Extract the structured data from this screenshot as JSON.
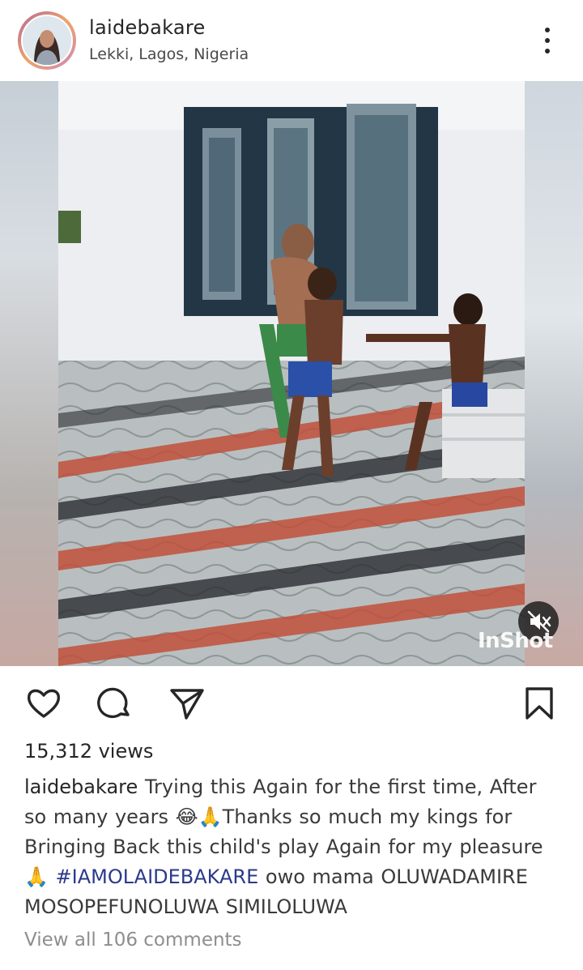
{
  "post": {
    "username": "laidebakare",
    "location": "Lekki, Lagos, Nigeria",
    "watermark": "InShot",
    "views": "15,312 views",
    "caption": {
      "username": "laidebakare",
      "text_1": " Trying this Again for the first time, After so many years ",
      "emoji_1": "😂🙏",
      "text_2": "Thanks so much my kings for Bringing Back this child's play Again for my pleasure ",
      "emoji_2": "🙏",
      "hashtag": "#IAMOLAIDEBAKARE",
      "text_3": " owo mama OLUWADAMIRE MOSOPEFUNOLUWA SIMILOLUWA"
    },
    "view_comments": "View all 106 comments"
  },
  "icons": {
    "more": "more-vertical-icon",
    "like": "heart-icon",
    "comment": "comment-bubble-icon",
    "share": "paper-plane-icon",
    "save": "bookmark-icon",
    "mute": "speaker-muted-icon"
  },
  "colors": {
    "text": "#262626",
    "muted": "#8e8e8e",
    "hashtag": "#2b3a8a"
  }
}
